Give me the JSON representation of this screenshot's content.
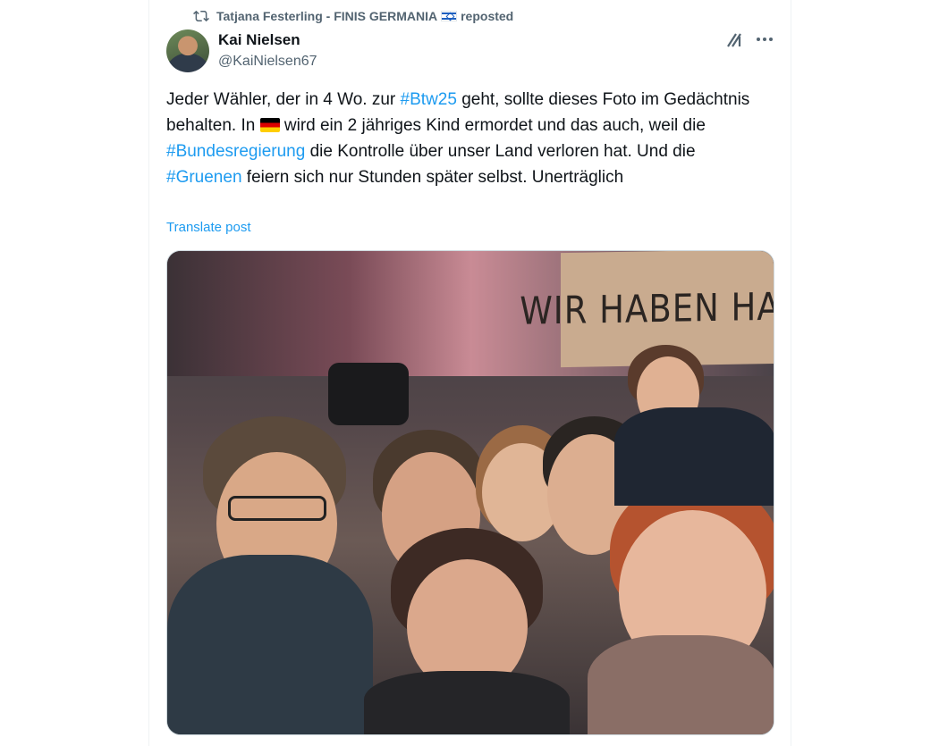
{
  "repost": {
    "reposter": "Tatjana Festerling - FINIS GERMANIA",
    "flag_icon": "israel-flag-icon",
    "suffix": "reposted"
  },
  "author": {
    "name": "Kai Nielsen",
    "handle": "@KaiNielsen67"
  },
  "post": {
    "segments": [
      {
        "text": "Jeder Wähler, der in 4 Wo. zur ",
        "type": "text"
      },
      {
        "text": "#Btw25",
        "type": "hashtag"
      },
      {
        "text": "  geht, sollte dieses Foto im Gedächtnis behalten. In ",
        "type": "text"
      },
      {
        "text": "🇩🇪",
        "type": "flag-de"
      },
      {
        "text": " wird ein 2 jähriges Kind ermordet und das auch, weil die ",
        "type": "text"
      },
      {
        "text": "#Bundesregierung",
        "type": "hashtag"
      },
      {
        "text": " die Kontrolle über unser Land verloren hat. Und die ",
        "type": "text"
      },
      {
        "text": "#Gruenen",
        "type": "hashtag"
      },
      {
        "text": " feiern sich nur Stunden später selbst. Unerträglich",
        "type": "text"
      }
    ],
    "translate_label": "Translate post"
  },
  "media": {
    "sign_text": "WIR HABEN HALT",
    "alt": ""
  },
  "icons": {
    "repost": "repost-icon",
    "grok": "grok-icon",
    "more": "more-icon"
  },
  "colors": {
    "accent": "#1d9bf0",
    "secondary_text": "#536471",
    "primary_text": "#0f1419"
  }
}
